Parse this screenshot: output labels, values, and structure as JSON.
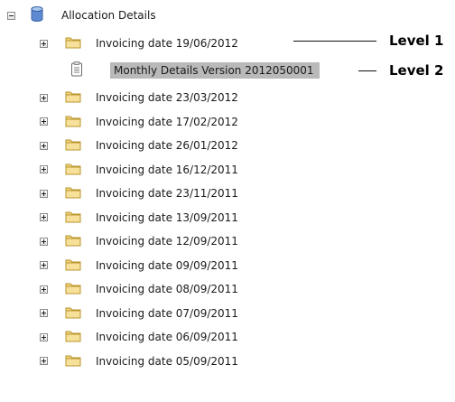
{
  "tree": {
    "root": {
      "label": "Allocation Details",
      "icon": "database-icon",
      "state": "expanded"
    },
    "level1_first": {
      "label": "Invoicing date 19/06/2012",
      "icon": "folder-icon",
      "state": "collapsed"
    },
    "level2_selected": {
      "label": "Monthly Details Version 2012050001",
      "icon": "document-icon",
      "selected": true
    },
    "items": [
      {
        "label": "Invoicing date 23/03/2012"
      },
      {
        "label": "Invoicing date 17/02/2012"
      },
      {
        "label": "Invoicing date 26/01/2012"
      },
      {
        "label": "Invoicing date 16/12/2011"
      },
      {
        "label": "Invoicing date 23/11/2011"
      },
      {
        "label": "Invoicing date 13/09/2011"
      },
      {
        "label": "Invoicing date 12/09/2011"
      },
      {
        "label": "Invoicing date 09/09/2011"
      },
      {
        "label": "Invoicing date 08/09/2011"
      },
      {
        "label": "Invoicing date 07/09/2011"
      },
      {
        "label": "Invoicing date 06/09/2011"
      },
      {
        "label": "Invoicing date 05/09/2011"
      }
    ]
  },
  "annotations": {
    "level1": "Level 1",
    "level2": "Level 2"
  },
  "colors": {
    "selection": "#b9b9b9",
    "folder": "#f2d27a"
  }
}
